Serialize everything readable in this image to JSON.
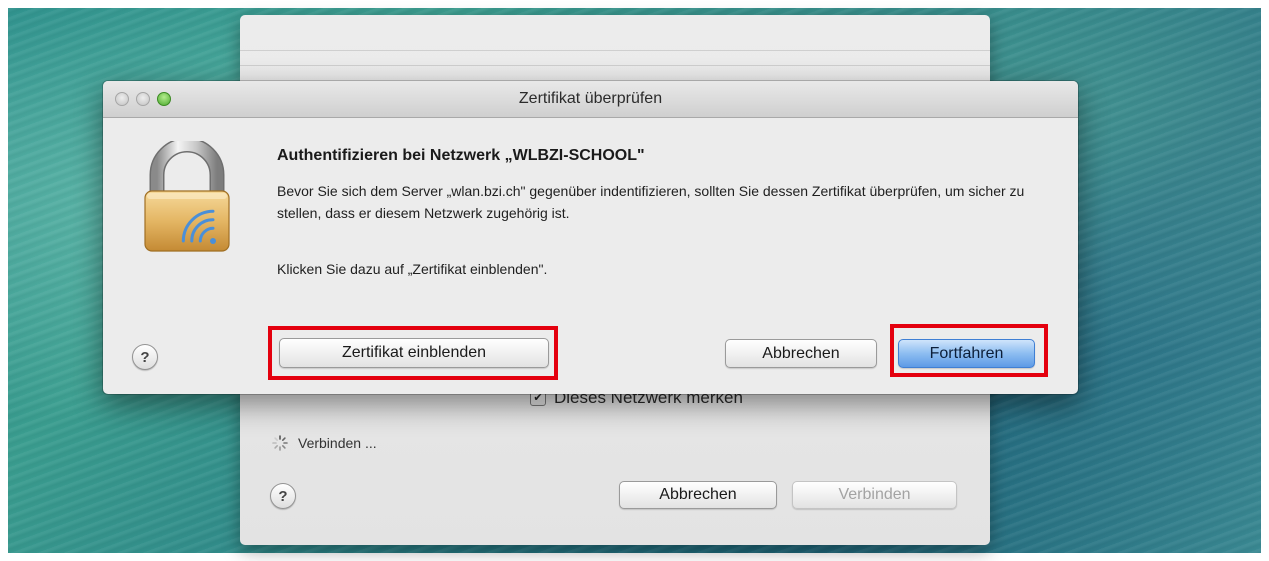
{
  "network_sheet": {
    "remember_label": "Dieses Netzwerk merken",
    "remember_checked_glyph": "✔",
    "connecting_label": "Verbinden ...",
    "help_label": "?",
    "cancel_label": "Abbrechen",
    "connect_label": "Verbinden"
  },
  "dialog": {
    "title": "Zertifikat überprüfen",
    "headline": "Authentifizieren bei Netzwerk „WLBZI-SCHOOL\"",
    "paragraph_1": "Bevor Sie sich dem Server „wlan.bzi.ch\" gegenüber indentifizieren, sollten Sie dessen Zertifikat überprüfen, um sicher zu stellen, dass er diesem Netzwerk zugehörig ist.",
    "paragraph_2": "Klicken Sie dazu auf „Zertifikat einblenden\".",
    "help_label": "?",
    "show_certificate_label": "Zertifikat einblenden",
    "cancel_label": "Abbrechen",
    "continue_label": "Fortfahren"
  },
  "icons": {
    "lock": "lock-wifi-icon",
    "spinner": "spinner-icon"
  },
  "colors": {
    "highlight": "#e4000e",
    "default_button": "#5d9ae6",
    "desktop_background": "#2b8f8b"
  }
}
